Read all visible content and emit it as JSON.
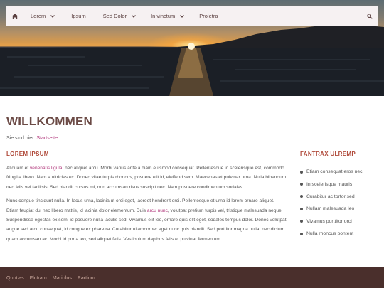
{
  "nav": {
    "items": [
      {
        "label": "Lorem",
        "has_dropdown": true
      },
      {
        "label": "Ipsum",
        "has_dropdown": false
      },
      {
        "label": "Sed Dolor",
        "has_dropdown": true
      },
      {
        "label": "In vinctum",
        "has_dropdown": true
      },
      {
        "label": "Proletra",
        "has_dropdown": false
      }
    ],
    "home_icon": "home-icon",
    "search_icon": "search-icon"
  },
  "page": {
    "title": "WILLKOMMEN",
    "breadcrumb_prefix": "Sie sind hier:",
    "breadcrumb_link": "Startseite"
  },
  "main": {
    "heading": "LOREM IPSUM",
    "p1_start": "Aliquam et ",
    "p1_link": "venenatis ligula",
    "p1_rest": ", nec aliquet arcu. Morbi varius ante a diam euismod consequat. Pellentesque id scelerisque est, commodo fringilla libero. Nam a ultricies ex. Donec vitae turpis rhoncus, posuere elit id, eleifend sem. Maecenas et pulvinar urna. Nulla bibendum nec felis vel facilisis. Sed blandit cursus mi, non accumsan risus suscipit nec. Nam posuere condimentum sodales.",
    "p2_start": "Nunc congue tincidunt nulla. In lacus urna, lacinia ut orci eget, laoreet hendrerit orci. Pellentesque et urna id lorem ornare aliquet. Etiam feugiat dui nec libero mattis, id lacinia dolor elementum. Duis ",
    "p2_link": "arcu nunc",
    "p2_rest": ", volutpat pretium turpis vel, tristique malesuada neque. Suspendisse egestas ex sem, id posuere nulla iaculis sed. Vivamus elit leo, ornare quis elit eget, sodales tempus dolor. Donec volutpat augue sed arcu consequat, id congue ex pharetra. Curabitur ullamcorper eget nunc quis blandit. Sed porttitor magna nulla, nec dictum quam accumsan ac. Morbi id porta leo, sed aliquet felis. Vestibulum dapibus felis et pulvinar fermentum."
  },
  "sidebar": {
    "heading": "FANTRAX ULREMP",
    "items": [
      "Etiam consequat eros nec",
      "In scelerisque mauris",
      "Curabitur ac tortor sed",
      "Nullam malesuada leo",
      "Vivamus porttitor orci",
      "Nulla rhoncus pontent"
    ]
  },
  "footer": {
    "links": [
      "Quntias",
      "Flctram",
      "Mariplus",
      "Partium"
    ]
  },
  "colors": {
    "accent_link": "#b0357a",
    "heading": "#b04a3a",
    "footer_bg": "#4a2f2c",
    "nav_bg": "#f6f1f2"
  }
}
